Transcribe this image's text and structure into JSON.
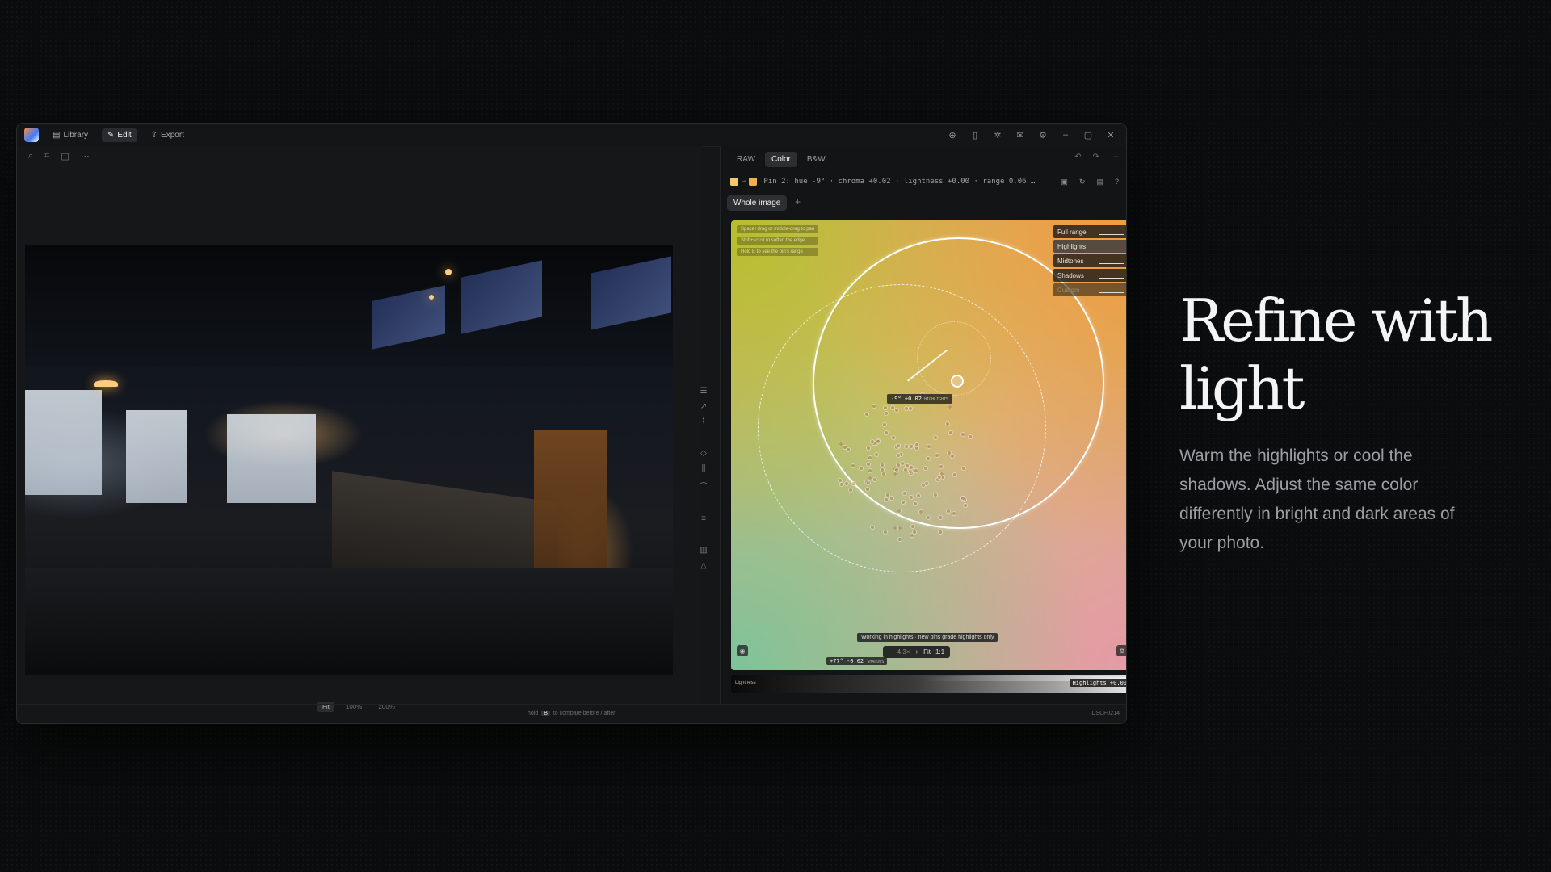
{
  "titlebar": {
    "nav": [
      {
        "label": "Library",
        "icon": "library-icon"
      },
      {
        "label": "Edit",
        "icon": "edit-icon"
      },
      {
        "label": "Export",
        "icon": "export-icon"
      }
    ]
  },
  "right_panel": {
    "tabs": [
      "RAW",
      "Color",
      "B&W"
    ],
    "pin_info": "Pin 2: hue -9° · chroma +0.02 · lightness +0.00 · range 0.06 …",
    "scope_button": "Whole image",
    "hints": [
      "Space+drag or middle-drag to pan",
      "Shift+scroll to soften the edge",
      "Hold E to see the pin's range"
    ],
    "ranges": [
      {
        "label": "Full range",
        "active": false
      },
      {
        "label": "Highlights",
        "active": true
      },
      {
        "label": "Midtones",
        "active": false
      },
      {
        "label": "Shadows",
        "active": false
      },
      {
        "label": "Custom",
        "active": false
      }
    ],
    "pin_label": "-9° +0.02",
    "pin_label_tag": "HIGHLIGHTS",
    "working_notice": "Working in highlights · new pins grade highlights only",
    "zoom": {
      "minus": "−",
      "value": "4.3×",
      "plus": "+",
      "fit": "Fit",
      "one": "1:1"
    },
    "readout": "+77° -0.02",
    "readout_tag": "SHADOWS",
    "lightness_label": "Lightness",
    "lightness_value": "Highlights +0.00"
  },
  "left_panel": {
    "zoom_options": [
      "Fit",
      "100%",
      "200%"
    ]
  },
  "statusbar": {
    "hint_prefix": "hold",
    "hint_key": "B",
    "hint_suffix": "to compare before / after",
    "filename": "DSCF0214"
  },
  "promo": {
    "headline": "Refine with light",
    "description": "Warm the highlights or cool the shadows. Adjust the same color differently in bright and dark areas of your photo."
  },
  "colors": {
    "accent_warm": "#f29a3a",
    "accent_green": "#b7bf2a",
    "swatch_1": "#f5c96a",
    "swatch_2": "#f2b04a"
  }
}
